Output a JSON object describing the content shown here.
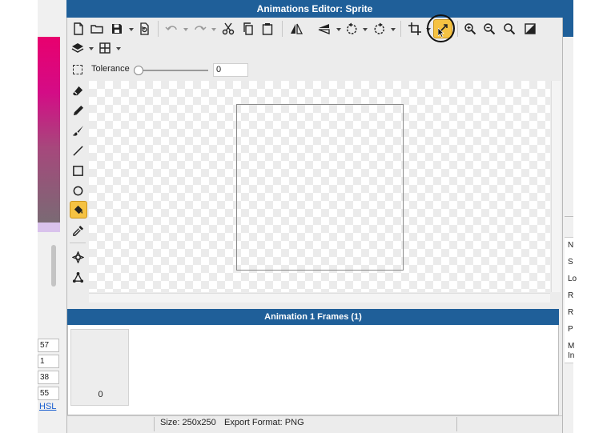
{
  "window": {
    "title": "Animations Editor: Sprite"
  },
  "toolbar": {
    "items": [
      "new-file",
      "open-folder",
      "save",
      "save-menu",
      "revert",
      "undo",
      "undo-menu",
      "redo",
      "redo-menu",
      "cut",
      "copy",
      "paste",
      "flip-horizontal",
      "flip-vertical",
      "flip-menu",
      "rotate-left",
      "rotate-left-menu",
      "rotate-right",
      "rotate-right-menu",
      "crop",
      "crop-menu",
      "resize",
      "zoom-in",
      "zoom-out",
      "zoom-fit",
      "invert"
    ],
    "row2": [
      "layers",
      "layers-menu",
      "grid",
      "grid-menu"
    ]
  },
  "options": {
    "tolerance_label": "Tolerance",
    "tolerance_value": "0",
    "tolerance_level": 0
  },
  "tools": [
    "eraser",
    "pencil",
    "brush",
    "line",
    "rectangle",
    "ellipse",
    "paint-bucket",
    "eyedropper",
    "move-point",
    "node-tool"
  ],
  "canvas": {
    "sprite_size": "250x250"
  },
  "frames_panel": {
    "title": "Animation 1 Frames (1)",
    "frames": [
      {
        "index": "0"
      }
    ]
  },
  "status": {
    "size": "Size: 250x250",
    "format": "Export Format: PNG"
  },
  "left_panel": {
    "values": [
      "57",
      "1",
      "38",
      "55"
    ],
    "link": "HSL"
  },
  "right_panel": {
    "labels": [
      "N",
      "S",
      "Lo",
      "R",
      "R",
      "P",
      "M",
      "In"
    ]
  },
  "colors": {
    "titlebar": "#1f5f99",
    "accent": "#f5c242",
    "frames_header": "#1f5f99"
  }
}
